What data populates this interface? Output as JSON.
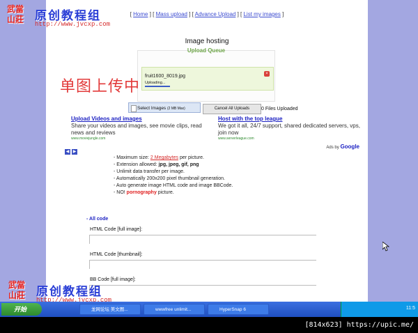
{
  "nav": {
    "links": [
      "Home",
      "Mass upload",
      "Advance Upload",
      "List my images"
    ]
  },
  "page": {
    "title": "Image hosting",
    "queue_title": "Upload Queue"
  },
  "upload_item": {
    "filename": "fruit1600_8019.jpg",
    "status": "Uploading...",
    "progress": 0.2,
    "cancel_icon": "close-icon"
  },
  "overlay_text": "单图上传中",
  "buttons": {
    "select_images": "Select Images",
    "select_images_note": "(2 MB Max)",
    "cancel_all": "Cancel All Uploads",
    "files_uploaded": "0 Files Uploaded"
  },
  "ads": [
    {
      "headline": "Upload Videos and images",
      "body": "Share your videos and images, see movie clips, read news and reviews",
      "url": "www.moviejungle.com"
    },
    {
      "headline": "Host with the top league",
      "body": "We got it all, 24/7 support, shared dedicated servers, vps, join now",
      "url": "www.serverleague.com"
    }
  ],
  "ads_by": "Ads by",
  "ads_brand": "Google",
  "features": {
    "max_size_prefix": "- Maximum size: ",
    "max_size_value": "2 Megabytes",
    "max_size_suffix": " per picture.",
    "ext_prefix": "- Extension allowed: ",
    "ext_value": "jpg, jpeg, gif, png",
    "unlimited": "- Unlimit data transfer per image.",
    "thumb": "- Automatically 200x200 pixel thumbnail generation.",
    "bbcode": "- Auto generate image HTML code and image BBCode.",
    "no_prefix": "- NO! ",
    "no_value": "pornography",
    "no_suffix": " picture."
  },
  "code_section": {
    "all_code": "- All code",
    "html_full": "HTML Code [full image]:",
    "html_thumb": "HTML Code [thumbnail]:",
    "bb_full": "BB Code [full image]:"
  },
  "watermark": {
    "seal": "武當山莊",
    "title": "原创教程组",
    "url": "http://www.jvcxp.com"
  },
  "taskbar": {
    "start": "开始",
    "items": [
      "龙网论坛 美文图...",
      "wwwfree unlimit...",
      "HyperSnap 6"
    ],
    "time": "11:5"
  },
  "footer_text": "[814x623] https://upic.me/",
  "colors": {
    "desktop": "#a3a7e1",
    "accent_green": "#6fa64a",
    "link_blue": "#1a1fc2",
    "overlay_red": "#e23a3a"
  }
}
